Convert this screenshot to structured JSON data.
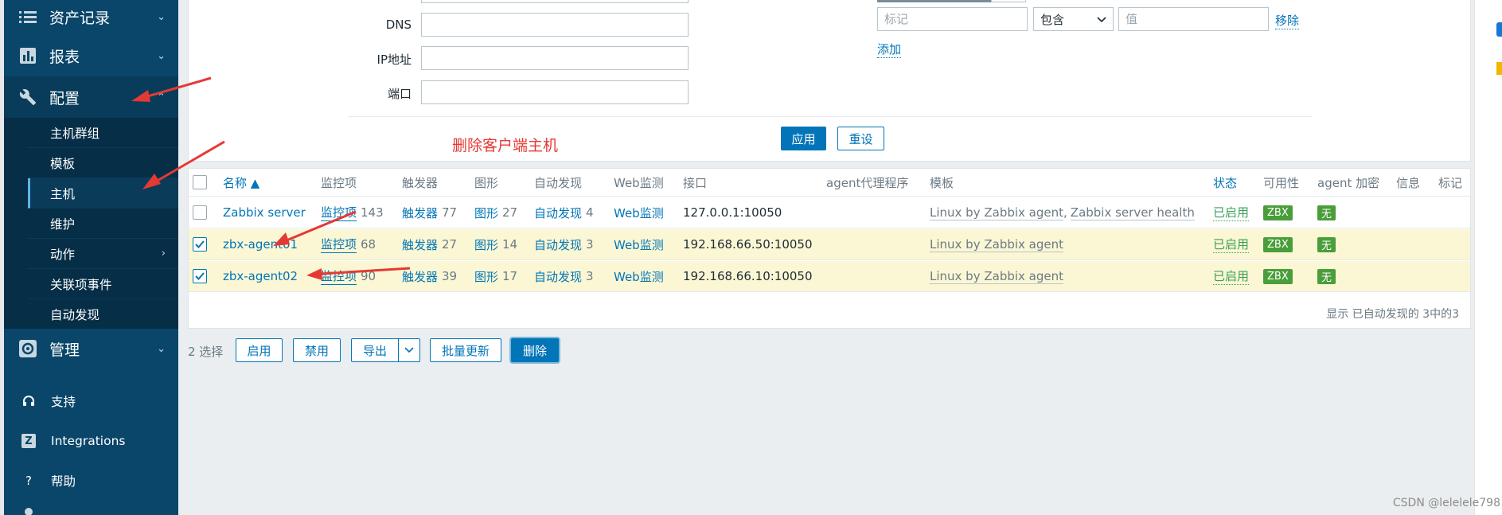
{
  "sidebar": {
    "menu": [
      {
        "label": "资产记录",
        "icon": "list-icon",
        "chevron": "⌄"
      },
      {
        "label": "报表",
        "icon": "bar-chart-icon",
        "chevron": "⌄"
      },
      {
        "label": "配置",
        "icon": "wrench-icon",
        "chevron": "⌃"
      }
    ],
    "submenu": [
      {
        "label": "主机群组"
      },
      {
        "label": "模板"
      },
      {
        "label": "主机"
      },
      {
        "label": "维护"
      },
      {
        "label": "动作",
        "chevron": "›"
      },
      {
        "label": "关联项事件"
      },
      {
        "label": "自动发现"
      }
    ],
    "admin": {
      "label": "管理",
      "icon": "gear-icon",
      "chevron": "⌄"
    },
    "bottom": [
      {
        "label": "支持",
        "icon": "headset-icon"
      },
      {
        "label": "Integrations",
        "icon": "z-icon",
        "glyph": "Z"
      },
      {
        "label": "帮助",
        "icon": "help-icon",
        "glyph": "?"
      }
    ]
  },
  "filter": {
    "dns_label": "DNS",
    "ip_label": "IP地址",
    "port_label": "端口",
    "tag_placeholder": "标记",
    "tag_operator": "包含",
    "value_placeholder": "值",
    "remove_label": "移除",
    "add_label": "添加",
    "apply_label": "应用",
    "reset_label": "重设"
  },
  "annotation": "删除客户端主机",
  "table": {
    "headers": {
      "name": "名称 ▲",
      "items": "监控项",
      "triggers": "触发器",
      "graphs": "图形",
      "discovery": "自动发现",
      "web": "Web监测",
      "interface": "接口",
      "proxy": "agent代理程序",
      "templates": "模板",
      "status": "状态",
      "availability": "可用性",
      "encryption": "agent 加密",
      "info": "信息",
      "tags": "标记"
    },
    "rows": [
      {
        "name": "Zabbix server",
        "items_label": "监控项",
        "items": "143",
        "triggers_label": "触发器",
        "triggers": "77",
        "graphs_label": "图形",
        "graphs": "27",
        "discovery_label": "自动发现",
        "discovery": "4",
        "web": "Web监测",
        "interface": "127.0.0.1:10050",
        "template1": "Linux by Zabbix agent",
        "sep": ",",
        "template2": "Zabbix server health",
        "status": "已启用",
        "availability": "ZBX",
        "encryption": "无",
        "checked": false
      },
      {
        "name": "zbx-agent01",
        "items_label": "监控项",
        "items": "68",
        "triggers_label": "触发器",
        "triggers": "27",
        "graphs_label": "图形",
        "graphs": "14",
        "discovery_label": "自动发现",
        "discovery": "3",
        "web": "Web监测",
        "interface": "192.168.66.50:10050",
        "template1": "Linux by Zabbix agent",
        "status": "已启用",
        "availability": "ZBX",
        "encryption": "无",
        "checked": true
      },
      {
        "name": "zbx-agent02",
        "items_label": "监控项",
        "items": "90",
        "triggers_label": "触发器",
        "triggers": "39",
        "graphs_label": "图形",
        "graphs": "17",
        "discovery_label": "自动发现",
        "discovery": "3",
        "web": "Web监测",
        "interface": "192.168.66.10:10050",
        "template1": "Linux by Zabbix agent",
        "status": "已启用",
        "availability": "ZBX",
        "encryption": "无",
        "checked": true
      }
    ],
    "footer": "显示 已自动发现的 3中的3"
  },
  "actions": {
    "selected": "2 选择",
    "enable": "启用",
    "disable": "禁用",
    "export": "导出",
    "mass_update": "批量更新",
    "delete": "删除"
  },
  "watermark": "CSDN @lelelele798",
  "colors": {
    "sidebar": "#0a466a",
    "accent": "#0275b8",
    "enabled": "#3aa05a",
    "badge": "#4a9e3a",
    "selected_row": "#fbf7d4",
    "annotation": "#e53935"
  }
}
